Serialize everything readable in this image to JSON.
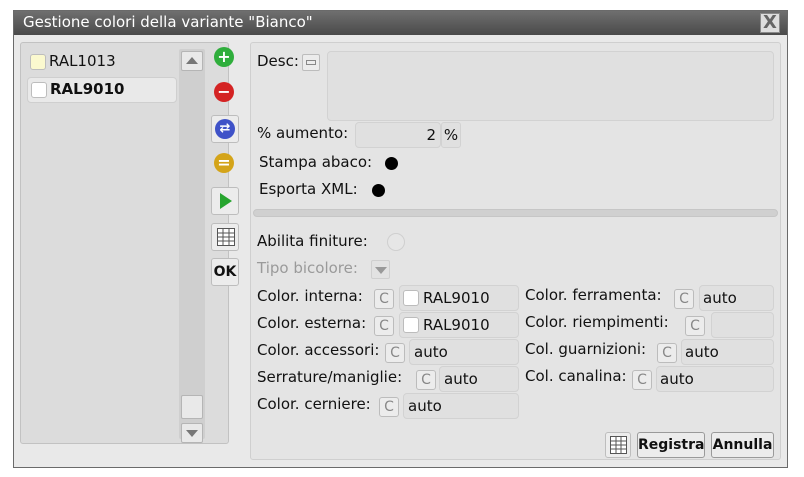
{
  "window": {
    "title": "Gestione colori della variante  \"Bianco\"",
    "close_glyph": "X"
  },
  "list": {
    "items": [
      {
        "label": "RAL1013",
        "swatch": "#fbf9cf",
        "selected": false
      },
      {
        "label": "RAL9010",
        "swatch": "#ffffff",
        "selected": true
      }
    ]
  },
  "toolbar": {
    "add_glyph": "+",
    "remove_glyph": "−",
    "ok_label": "OK"
  },
  "form": {
    "desc_label": "Desc:",
    "desc_value": "",
    "aumento_label": "% aumento:",
    "aumento_value": "2",
    "percent_btn": "%",
    "stampa_label": "Stampa abaco:",
    "esporta_label": "Esporta XML:",
    "abilita_label": "Abilita finiture:",
    "tipo_label": "Tipo bicolore:",
    "c_glyph": "C",
    "interna_label": "Color. interna:",
    "interna_value": "RAL9010",
    "esterna_label": "Color. esterna:",
    "esterna_value": "RAL9010",
    "accessori_label": "Color. accessori:",
    "accessori_value": "auto",
    "serrature_label": "Serrature/maniglie:",
    "serrature_value": "auto",
    "cerniere_label": "Color. cerniere:",
    "cerniere_value": "auto",
    "ferramenta_label": "Color. ferramenta:",
    "ferramenta_value": "auto",
    "riempimenti_label": "Color. riempimenti:",
    "riempimenti_value": "",
    "guarnizioni_label": "Col. guarnizioni:",
    "guarnizioni_value": "auto",
    "canalina_label": "Col. canalina:",
    "canalina_value": "auto"
  },
  "footer": {
    "registra_label": "Registra",
    "annulla_label": "Annulla"
  },
  "colors": {
    "add": "#2fae3c",
    "remove": "#d42323",
    "duplicate": "#3f52c8",
    "equal": "#d4a419",
    "play": "#27a52f"
  }
}
